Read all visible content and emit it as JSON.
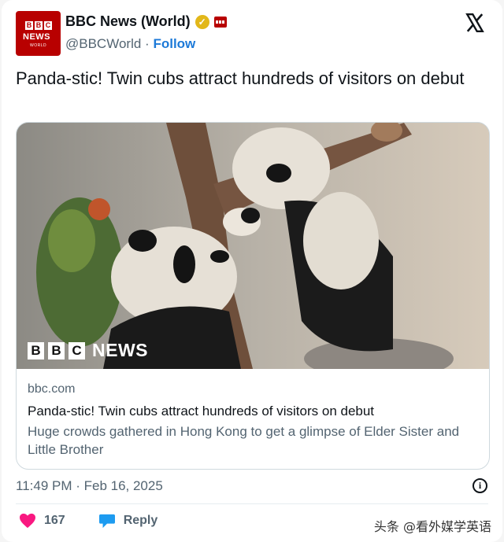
{
  "account": {
    "display_name": "BBC News (World)",
    "handle": "@BBCWorld",
    "separator": "·",
    "follow_label": "Follow",
    "avatar_letters": [
      "B",
      "B",
      "C"
    ],
    "avatar_news": "NEWS",
    "avatar_world": "WORLD"
  },
  "post": {
    "text": "Panda-stic! Twin cubs attract hundreds of visitors on debut"
  },
  "link_card": {
    "domain": "bbc.com",
    "title": "Panda-stic! Twin cubs attract hundreds of visitors on debut",
    "description": "Huge crowds gathered in Hong Kong to get a glimpse of Elder Sister and Little Brother",
    "image_logo_letters": [
      "B",
      "B",
      "C"
    ],
    "image_logo_word": "NEWS"
  },
  "timestamp": "11:49 PM · Feb 16, 2025",
  "actions": {
    "like_count": "167",
    "reply_label": "Reply"
  },
  "watermark": "头条 @看外媒学英语",
  "colors": {
    "bbc_red": "#b80000",
    "verified_gold": "#e2b719",
    "follow_blue": "#1d7ad8",
    "like_pink": "#f91880",
    "reply_blue": "#1d9bf0"
  },
  "icons": [
    "x-logo-icon",
    "verified-badge-icon",
    "affiliate-badge-icon",
    "info-icon",
    "heart-icon",
    "reply-icon"
  ]
}
